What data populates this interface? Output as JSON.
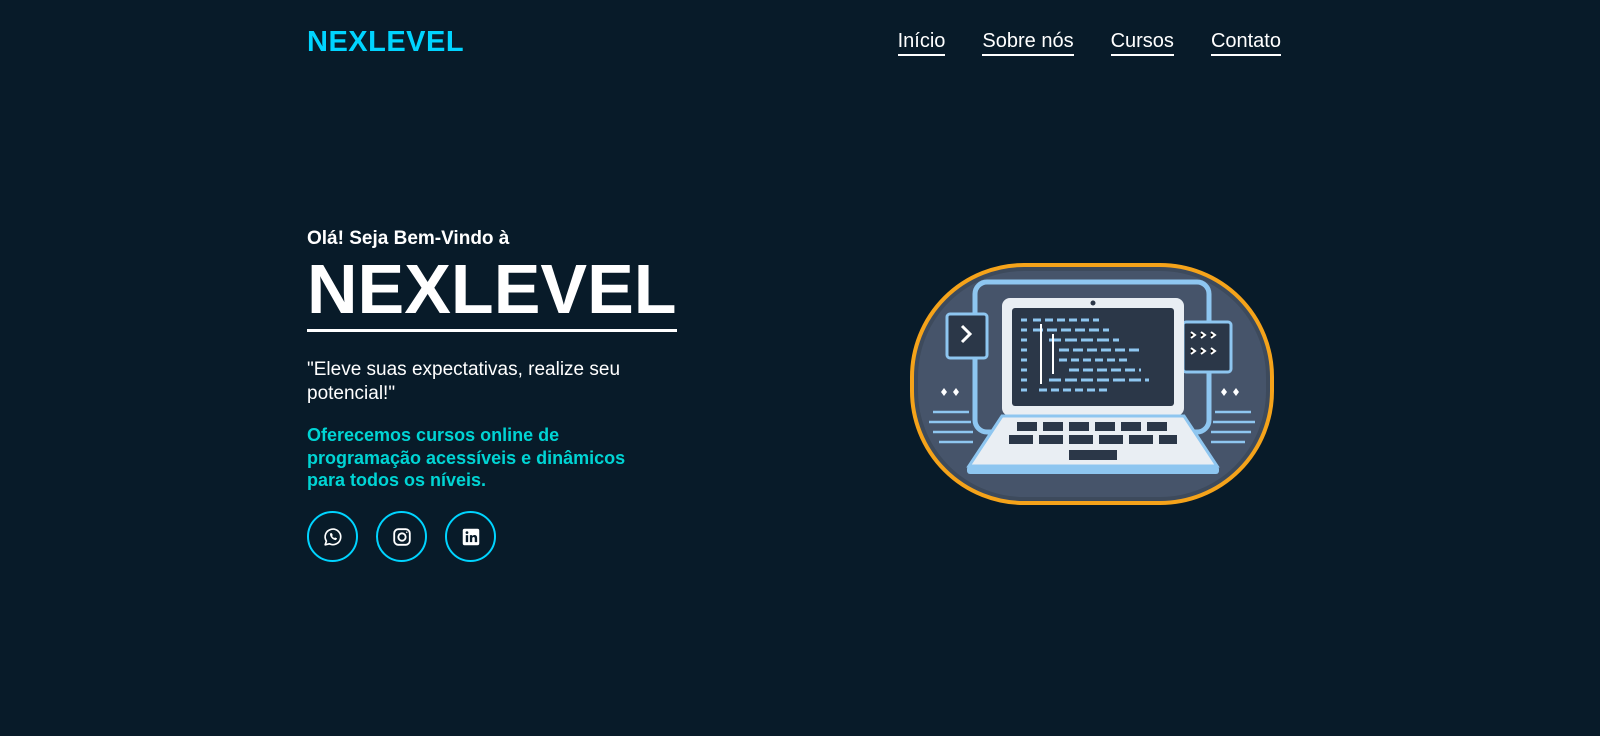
{
  "header": {
    "logo": "NEXLEVEL",
    "nav": [
      {
        "label": "Início"
      },
      {
        "label": "Sobre nós"
      },
      {
        "label": "Cursos"
      },
      {
        "label": "Contato"
      }
    ]
  },
  "hero": {
    "greeting": "Olá! Seja Bem-Vindo à",
    "brand": "NEXLEVEL",
    "quote": "\"Eleve suas expectativas, realize seu potencial!\"",
    "offer": "Oferecemos cursos online de programação acessíveis e dinâmicos para todos os níveis."
  },
  "socials": [
    {
      "icon": "whatsapp-icon"
    },
    {
      "icon": "instagram-icon"
    },
    {
      "icon": "linkedin-icon"
    }
  ],
  "illustration": {
    "icon": "laptop-code-icon"
  },
  "colors": {
    "background": "#081b29",
    "accent": "#00d4ff",
    "offer_text": "#00d4d4",
    "illustration_border": "#f5a31a"
  }
}
